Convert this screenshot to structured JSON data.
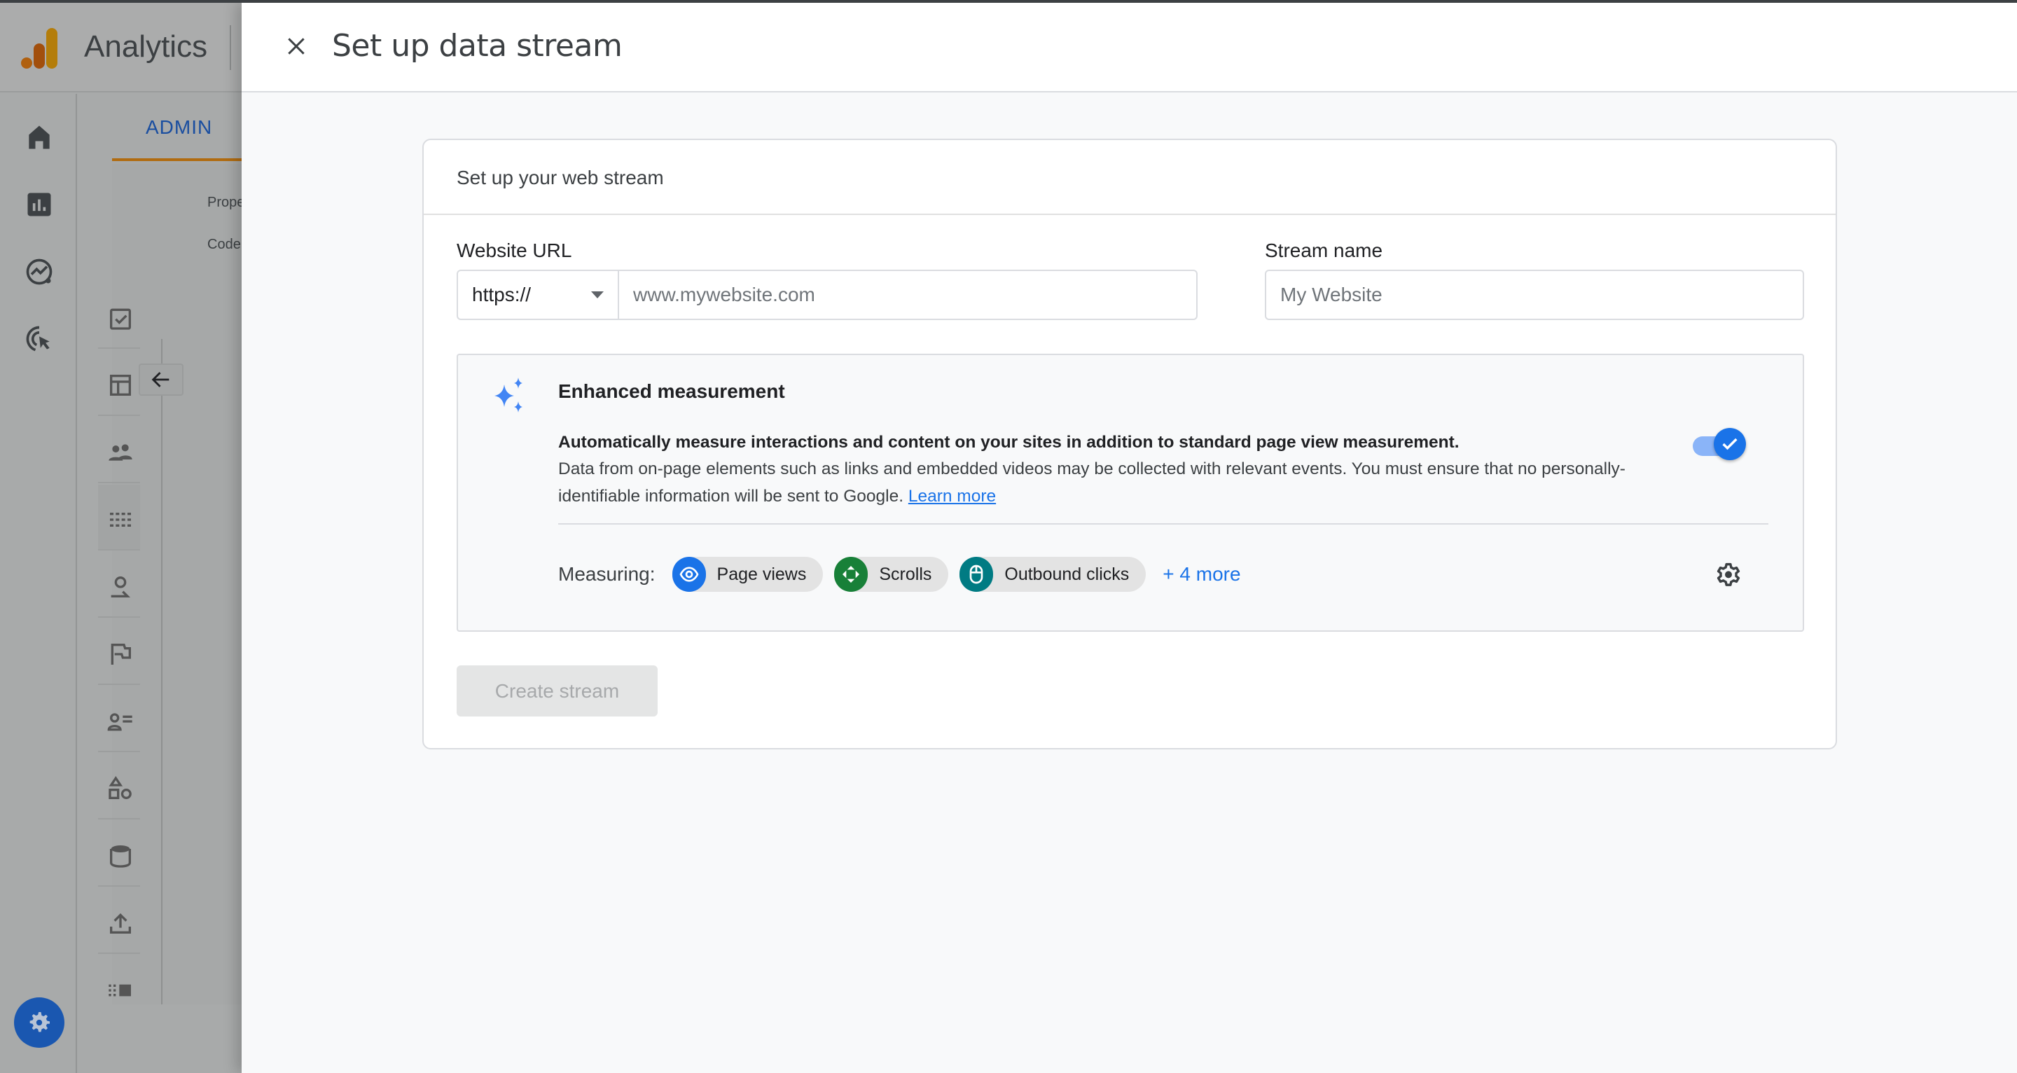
{
  "app": {
    "name": "Analytics",
    "active_tab": "ADMIN",
    "background_labels": [
      "Prope",
      "Code"
    ],
    "rail_icons": [
      "home-icon",
      "reports-icon",
      "explore-icon",
      "advertising-icon"
    ],
    "settings_icon": "admin-gear-icon"
  },
  "sheet": {
    "title": "Set up data stream",
    "close_icon": "close-icon"
  },
  "card": {
    "heading": "Set up your web stream",
    "website_url": {
      "label": "Website URL",
      "protocol_selected": "https://",
      "placeholder": "www.mywebsite.com",
      "value": ""
    },
    "stream_name": {
      "label": "Stream name",
      "placeholder": "My Website",
      "value": ""
    },
    "enhanced_measurement": {
      "title": "Enhanced measurement",
      "lead": "Automatically measure interactions and content on your sites in addition to standard page view measurement.",
      "description": "Data from on-page elements such as links and embedded videos may be collected with relevant events. You must ensure that no personally-identifiable information will be sent to Google.",
      "learn_more": "Learn more",
      "enabled": true,
      "measuring_label": "Measuring:",
      "chips": [
        {
          "label": "Page views",
          "icon": "eye-icon",
          "color": "#1a73e8"
        },
        {
          "label": "Scrolls",
          "icon": "scroll-arrows-icon",
          "color": "#188038"
        },
        {
          "label": "Outbound clicks",
          "icon": "mouse-icon",
          "color": "#007b83"
        }
      ],
      "more_label": "+ 4 more"
    },
    "create_button": "Create stream"
  },
  "colors": {
    "accent": "#1a73e8",
    "tab_underline": "#b06b10",
    "page_bg": "#f8f9fa"
  }
}
